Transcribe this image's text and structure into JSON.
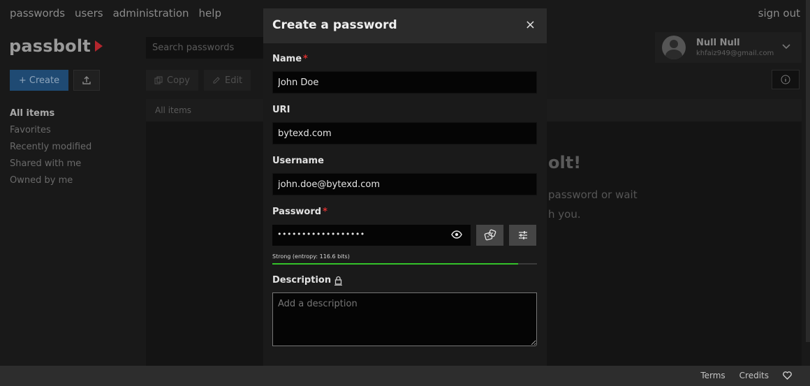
{
  "topnav": {
    "items": [
      "passwords",
      "users",
      "administration",
      "help"
    ],
    "signout": "sign out"
  },
  "logo": {
    "text": "passbolt"
  },
  "search": {
    "placeholder": "Search passwords"
  },
  "user": {
    "name": "Null Null",
    "email": "khfaiz949@gmail.com"
  },
  "actions": {
    "create": "+ Create",
    "copy": "Copy",
    "edit": "Edit"
  },
  "sidebar": {
    "items": [
      "All items",
      "Favorites",
      "Recently modified",
      "Shared with me",
      "Owned by me"
    ]
  },
  "main": {
    "breadcrumb": "All items",
    "empty_title": "olt!",
    "empty_line1": "password or wait",
    "empty_line2": "h you."
  },
  "footer": {
    "terms": "Terms",
    "credits": "Credits"
  },
  "modal": {
    "title": "Create a password",
    "close": "×",
    "name_label": "Name",
    "name_value": "John Doe",
    "uri_label": "URI",
    "uri_value": "bytexd.com",
    "username_label": "Username",
    "username_value": "john.doe@bytexd.com",
    "password_label": "Password",
    "password_masked": "••••••••••••••••••",
    "required_mark": "*",
    "entropy_text": "Strong (entropy: 116.6 bits)",
    "strength_fraction": 0.93,
    "strength_color": "#34c22a",
    "description_label": "Description",
    "description_placeholder": "Add a description"
  },
  "colors": {
    "accent": "#1f4a73",
    "required": "#d9302f",
    "brand": "#b3262d"
  },
  "icons": {
    "close": "close-icon",
    "eye": "eye-icon",
    "generate": "dice-icon",
    "settings": "sliders-icon",
    "lock": "lock-icon",
    "heart": "heart-icon",
    "info": "info-icon",
    "upload": "upload-icon",
    "chevron": "chevron-down-icon"
  }
}
